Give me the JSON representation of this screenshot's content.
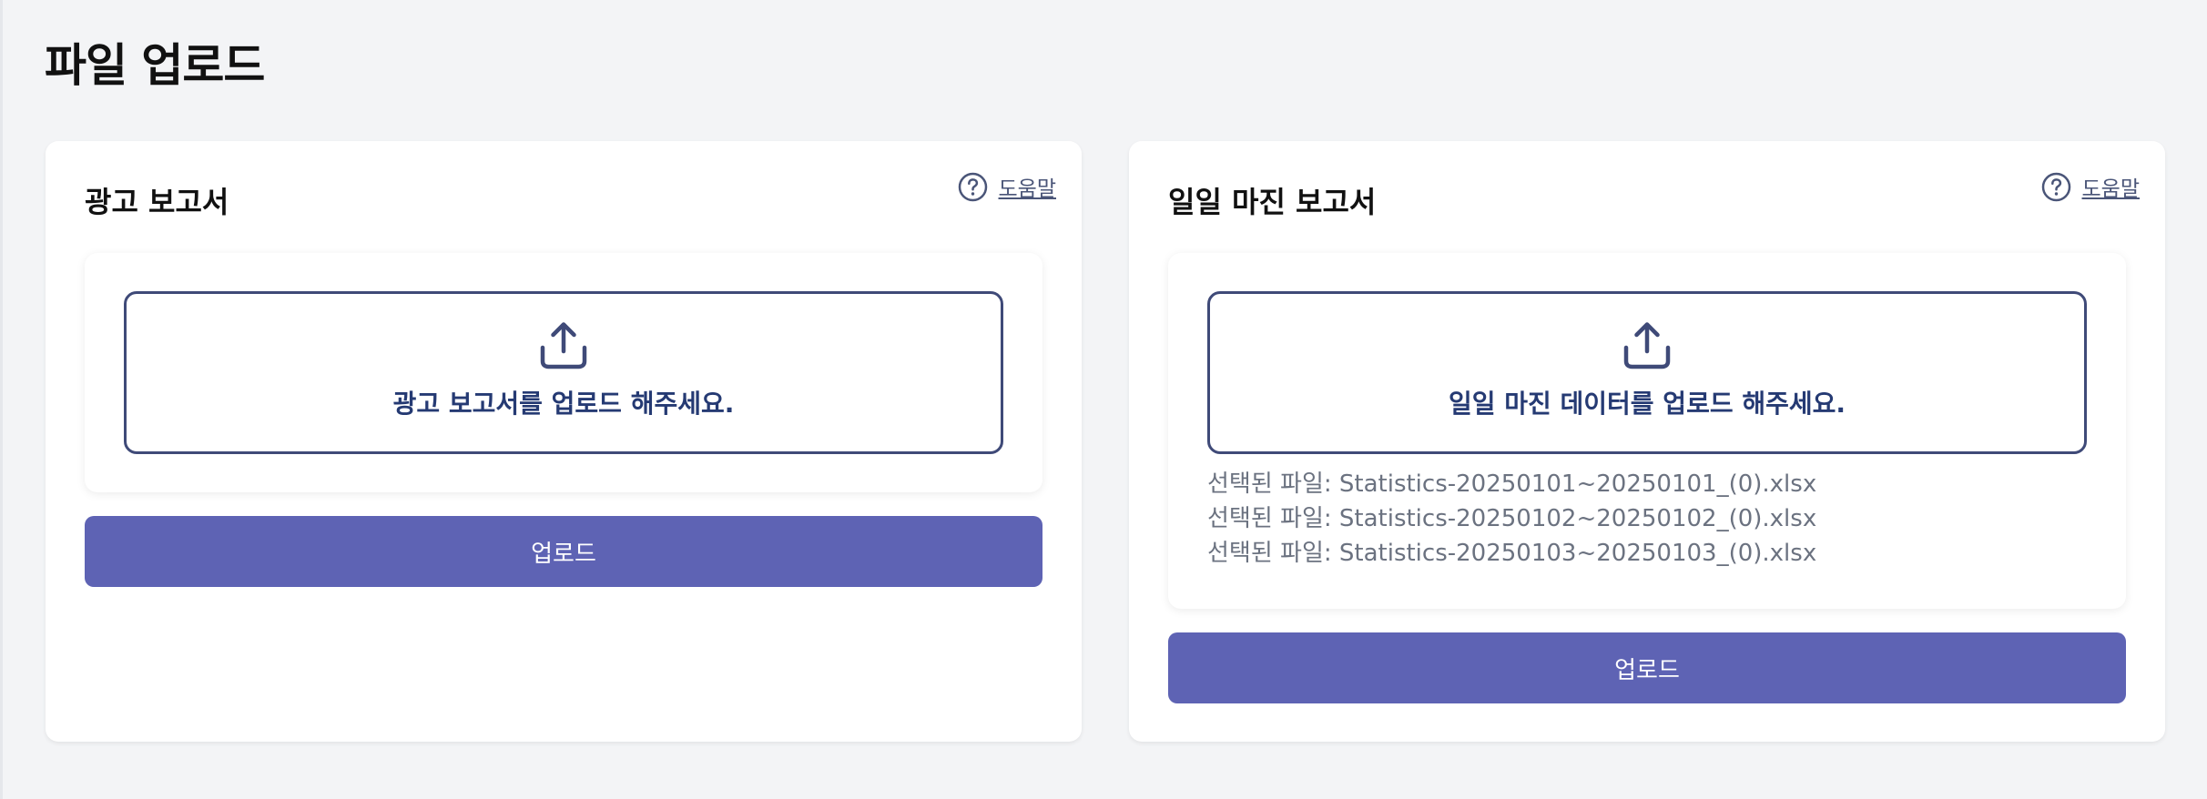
{
  "page": {
    "title": "파일 업로드"
  },
  "cards": [
    {
      "title": "광고 보고서",
      "help_label": "도움말",
      "help_icon": "question-circle-icon",
      "dropzone_icon": "upload-icon",
      "dropzone_label": "광고 보고서를 업로드 해주세요.",
      "selected_files": [],
      "button_label": "업로드"
    },
    {
      "title": "일일 마진 보고서",
      "help_label": "도움말",
      "help_icon": "question-circle-icon",
      "dropzone_icon": "upload-icon",
      "dropzone_label": "일일 마진 데이터를 업로드 해주세요.",
      "selected_files": [
        "선택된 파일: Statistics-20250101~20250101_(0).xlsx",
        "선택된 파일: Statistics-20250102~20250102_(0).xlsx",
        "선택된 파일: Statistics-20250103~20250103_(0).xlsx"
      ],
      "button_label": "업로드"
    }
  ],
  "colors": {
    "page_background": "#f3f4f6",
    "card_background": "#ffffff",
    "dropzone_border": "#3f4a78",
    "dropzone_text": "#253a73",
    "button_background": "#5e63b4",
    "button_text": "#ffffff",
    "help_link": "#4a5578",
    "file_text": "#6b7280"
  }
}
